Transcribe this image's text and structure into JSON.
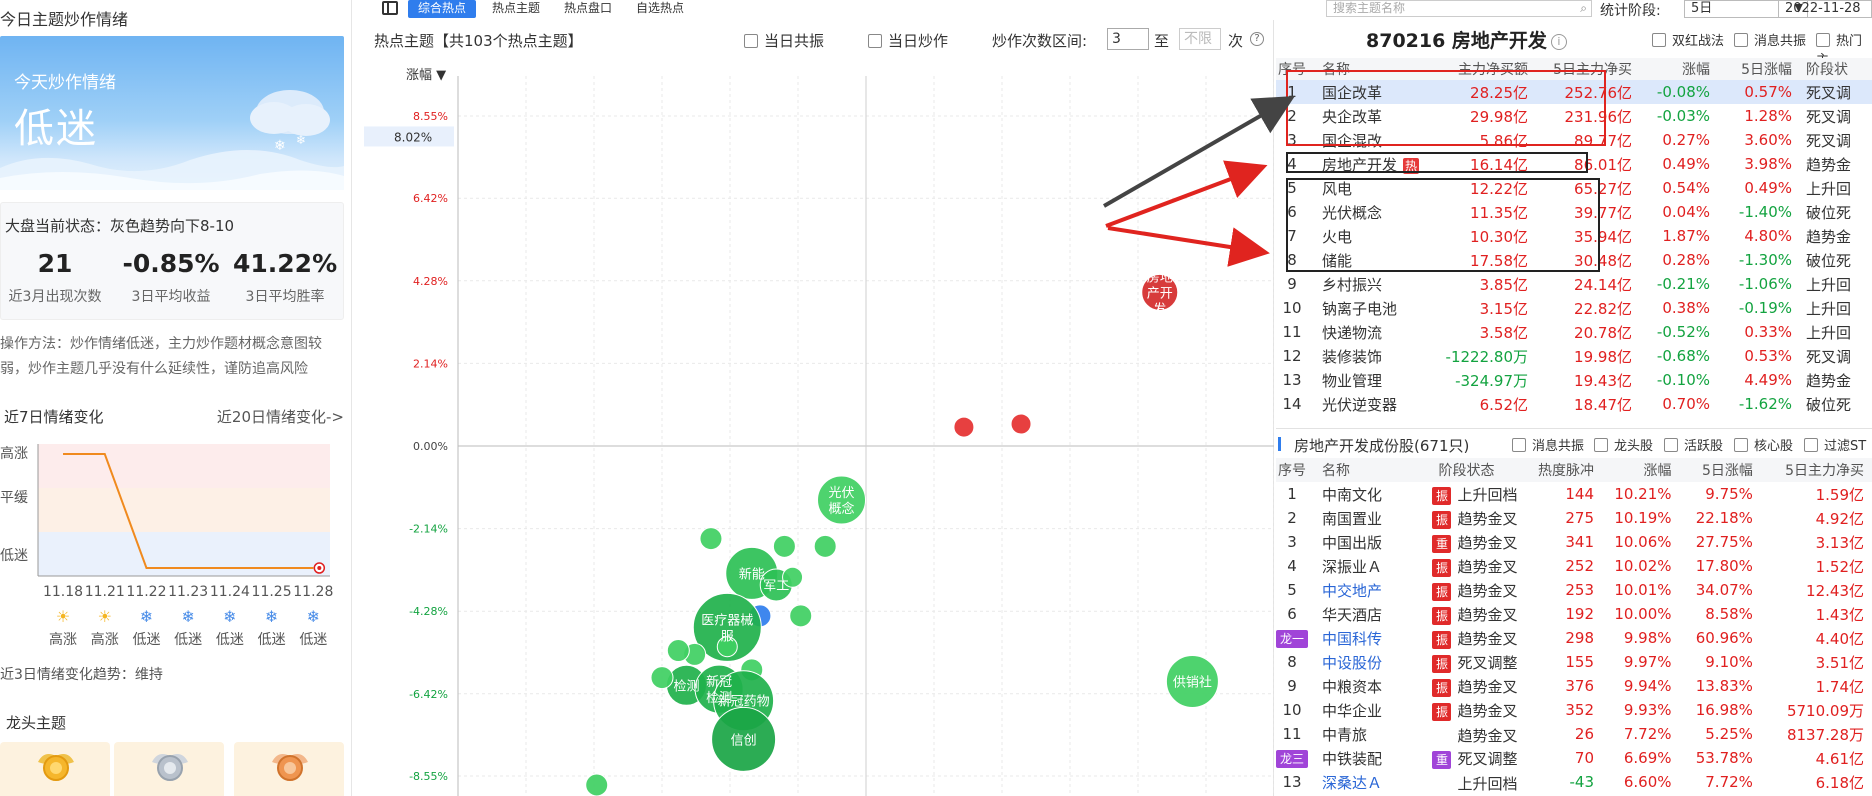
{
  "left": {
    "panel_title": "今日主题炒作情绪",
    "mood_label": "今天炒作情绪",
    "mood_value": "低迷",
    "market_status": "大盘当前状态：灰色趋势向下8-10",
    "kpis": [
      {
        "value": "21",
        "label": "近3月出现次数"
      },
      {
        "value": "-0.85%",
        "label": "3日平均收益"
      },
      {
        "value": "41.22%",
        "label": "3日平均胜率"
      }
    ],
    "method_line1": "操作方法：炒作情绪低迷，主力炒作题材概念意图较",
    "method_line2": "弱，炒作主题几乎没有什么延续性，谨防追高风险",
    "trend_title": "近7日情绪变化",
    "trend_link": "近20日情绪变化->",
    "trend_levels": [
      "高涨",
      "平缓",
      "低迷"
    ],
    "trend_dates": [
      "11.18",
      "11.21",
      "11.22",
      "11.23",
      "11.24",
      "11.25",
      "11.28"
    ],
    "trend_states": [
      "高涨",
      "高涨",
      "低迷",
      "低迷",
      "低迷",
      "低迷",
      "低迷"
    ],
    "trend_icons": [
      "sun-icon",
      "sun-icon",
      "snowflake-icon",
      "snowflake-icon",
      "snowflake-icon",
      "snowflake-icon",
      "snowflake-icon"
    ],
    "trend_note": "近3日情绪变化趋势：维持",
    "dragon_title": "龙头主题"
  },
  "topbar": {
    "tabs": [
      "综合热点",
      "热点主题",
      "热点盘口",
      "自选热点"
    ],
    "active_tab": 0,
    "search_placeholder": "搜索主题名称",
    "stage_label": "统计阶段:",
    "stage_value": "5日",
    "date_value": "2022-11-28"
  },
  "chart_header": {
    "title": "热点主题【共103个热点主题】",
    "check_resonance": "当日共振",
    "check_hype": "当日炒作",
    "range_label": "炒作次数区间:",
    "range_from": "3",
    "range_to_label": "至",
    "range_to_placeholder": "不限",
    "range_unit": "次",
    "sort_label": "涨幅 ▼",
    "current_marker": "8.02%"
  },
  "chart_data": {
    "type": "scatter",
    "ylabel": "涨幅",
    "yticks": [
      "8.55%",
      "6.42%",
      "4.28%",
      "2.14%",
      "0.00%",
      "-2.14%",
      "-4.28%",
      "-6.42%",
      "-8.55%"
    ],
    "ylim": [
      -8.55,
      8.55
    ],
    "bubbles": [
      {
        "label": "房地产开发",
        "y": 3.98,
        "xr": 0.86,
        "r": 18,
        "color": "#d42a2a"
      },
      {
        "label": "",
        "y": 0.49,
        "xr": 0.62,
        "r": 10,
        "color": "#e53030"
      },
      {
        "label": "",
        "y": 0.57,
        "xr": 0.69,
        "r": 10,
        "color": "#e53030"
      },
      {
        "label": "光伏概念",
        "y": -1.4,
        "xr": 0.47,
        "r": 24,
        "color": "#3fcf62"
      },
      {
        "label": "",
        "y": -2.6,
        "xr": 0.4,
        "r": 11,
        "color": "#3fcf62"
      },
      {
        "label": "",
        "y": -2.6,
        "xr": 0.45,
        "r": 11,
        "color": "#3fcf62"
      },
      {
        "label": "",
        "y": -2.4,
        "xr": 0.31,
        "r": 11,
        "color": "#3fcf62"
      },
      {
        "label": "新能",
        "y": -3.3,
        "xr": 0.36,
        "r": 26,
        "color": "#2cc055"
      },
      {
        "label": "军工",
        "y": -3.6,
        "xr": 0.39,
        "r": 16,
        "color": "#2cc055"
      },
      {
        "label": "",
        "y": -3.4,
        "xr": 0.41,
        "r": 10,
        "color": "#3fcf62"
      },
      {
        "label": "",
        "y": -4.4,
        "xr": 0.37,
        "r": 11,
        "color": "#2f7ded"
      },
      {
        "label": "",
        "y": -4.4,
        "xr": 0.42,
        "r": 11,
        "color": "#3fcf62"
      },
      {
        "label": "医疗器械服",
        "y": -4.7,
        "xr": 0.33,
        "r": 34,
        "color": "#1fb14b"
      },
      {
        "label": "",
        "y": -5.2,
        "xr": 0.33,
        "r": 10,
        "color": "#3fcf62"
      },
      {
        "label": "",
        "y": -5.4,
        "xr": 0.29,
        "r": 11,
        "color": "#3fcf62"
      },
      {
        "label": "",
        "y": -5.3,
        "xr": 0.27,
        "r": 11,
        "color": "#3fcf62"
      },
      {
        "label": "",
        "y": -5.8,
        "xr": 0.36,
        "r": 11,
        "color": "#3fcf62"
      },
      {
        "label": "检测",
        "y": -6.2,
        "xr": 0.28,
        "r": 20,
        "color": "#1fb14b"
      },
      {
        "label": "",
        "y": -6.0,
        "xr": 0.25,
        "r": 11,
        "color": "#3fcf62"
      },
      {
        "label": "新冠检测",
        "y": -6.3,
        "xr": 0.32,
        "r": 24,
        "color": "#1fb14b"
      },
      {
        "label": "新冠药物",
        "y": -6.6,
        "xr": 0.35,
        "r": 30,
        "color": "#1fb14b"
      },
      {
        "label": "信创",
        "y": -7.6,
        "xr": 0.35,
        "r": 32,
        "color": "#1aa545"
      },
      {
        "label": "供销社",
        "y": -6.1,
        "xr": 0.9,
        "r": 26,
        "color": "#3fcf62"
      },
      {
        "label": "",
        "y": -9.5,
        "xr": 0.17,
        "r": 11,
        "color": "#3fcf62"
      }
    ]
  },
  "hot_table": {
    "sector_title": "870216 房地产开发",
    "checks": [
      "双红战法",
      "消息共振",
      "热门主"
    ],
    "headers": [
      "序号",
      "名称",
      "主力净买额",
      "5日主力净买",
      "涨幅",
      "5日涨幅",
      "阶段状"
    ],
    "rows": [
      {
        "no": "1",
        "name": "国企改革",
        "net": "28.25亿",
        "net5": "252.76亿",
        "chg": "-0.08%",
        "chg5": "0.57%",
        "stage": "死叉调"
      },
      {
        "no": "2",
        "name": "央企改革",
        "net": "29.98亿",
        "net5": "231.96亿",
        "chg": "-0.03%",
        "chg5": "1.28%",
        "stage": "死叉调"
      },
      {
        "no": "3",
        "name": "国企混改",
        "net": "5.86亿",
        "net5": "89.77亿",
        "chg": "0.27%",
        "chg5": "3.60%",
        "stage": "死叉调"
      },
      {
        "no": "4",
        "name": "房地产开发",
        "net": "16.14亿",
        "net5": "86.01亿",
        "chg": "0.49%",
        "chg5": "3.98%",
        "stage": "趋势金"
      },
      {
        "no": "5",
        "name": "风电",
        "net": "12.22亿",
        "net5": "65.27亿",
        "chg": "0.54%",
        "chg5": "0.49%",
        "stage": "上升回"
      },
      {
        "no": "6",
        "name": "光伏概念",
        "net": "11.35亿",
        "net5": "39.77亿",
        "chg": "0.04%",
        "chg5": "-1.40%",
        "stage": "破位死"
      },
      {
        "no": "7",
        "name": "火电",
        "net": "10.30亿",
        "net5": "35.94亿",
        "chg": "1.87%",
        "chg5": "4.80%",
        "stage": "趋势金"
      },
      {
        "no": "8",
        "name": "储能",
        "net": "17.58亿",
        "net5": "30.48亿",
        "chg": "0.28%",
        "chg5": "-1.30%",
        "stage": "破位死"
      },
      {
        "no": "9",
        "name": "乡村振兴",
        "net": "3.85亿",
        "net5": "24.14亿",
        "chg": "-0.21%",
        "chg5": "-1.06%",
        "stage": "上升回"
      },
      {
        "no": "10",
        "name": "钠离子电池",
        "net": "3.15亿",
        "net5": "22.82亿",
        "chg": "0.38%",
        "chg5": "-0.19%",
        "stage": "上升回"
      },
      {
        "no": "11",
        "name": "快递物流",
        "net": "3.58亿",
        "net5": "20.78亿",
        "chg": "-0.52%",
        "chg5": "0.33%",
        "stage": "上升回"
      },
      {
        "no": "12",
        "name": "装修装饰",
        "net": "-1222.80万",
        "net5": "19.98亿",
        "chg": "-0.68%",
        "chg5": "0.53%",
        "stage": "死叉调"
      },
      {
        "no": "13",
        "name": "物业管理",
        "net": "-324.97万",
        "net5": "19.43亿",
        "chg": "-0.10%",
        "chg5": "4.49%",
        "stage": "趋势金"
      },
      {
        "no": "14",
        "name": "光伏逆变器",
        "net": "6.52亿",
        "net5": "18.47亿",
        "chg": "0.70%",
        "chg5": "-1.62%",
        "stage": "破位死"
      }
    ],
    "hot_tag": "热"
  },
  "const_table": {
    "title": "房地产开发成份股(671只)",
    "checks": [
      "消息共振",
      "龙头股",
      "活跃股",
      "核心股",
      "过滤ST"
    ],
    "headers": [
      "序号",
      "名称",
      "阶段状态",
      "热度脉冲",
      "涨幅",
      "5日涨幅",
      "5日主力净买"
    ],
    "rows": [
      {
        "no": "1",
        "name": "中南文化",
        "badge": "振",
        "bc": "r",
        "stage": "上升回档",
        "heat": "144",
        "chg": "10.21%",
        "chg5": "9.75%",
        "net5": "1.59亿",
        "blue": false
      },
      {
        "no": "2",
        "name": "南国置业",
        "badge": "振",
        "bc": "r",
        "stage": "趋势金叉",
        "heat": "275",
        "chg": "10.19%",
        "chg5": "22.18%",
        "net5": "4.92亿",
        "blue": false
      },
      {
        "no": "3",
        "name": "中国出版",
        "badge": "重",
        "bc": "r",
        "stage": "趋势金叉",
        "heat": "341",
        "chg": "10.06%",
        "chg5": "27.75%",
        "net5": "3.13亿",
        "blue": false
      },
      {
        "no": "4",
        "name": "深振业Ａ",
        "badge": "振",
        "bc": "r",
        "stage": "趋势金叉",
        "heat": "252",
        "chg": "10.02%",
        "chg5": "17.80%",
        "net5": "1.52亿",
        "blue": false
      },
      {
        "no": "5",
        "name": "中交地产",
        "badge": "振",
        "bc": "r",
        "stage": "趋势金叉",
        "heat": "253",
        "chg": "10.01%",
        "chg5": "34.07%",
        "net5": "12.43亿",
        "blue": true
      },
      {
        "no": "6",
        "name": "华天酒店",
        "badge": "振",
        "bc": "r",
        "stage": "趋势金叉",
        "heat": "192",
        "chg": "10.00%",
        "chg5": "8.58%",
        "net5": "1.43亿",
        "blue": false
      },
      {
        "no": "龙一",
        "name": "中国科传",
        "badge": "振",
        "bc": "r",
        "stage": "趋势金叉",
        "heat": "298",
        "chg": "9.98%",
        "chg5": "60.96%",
        "net5": "4.40亿",
        "blue": true
      },
      {
        "no": "8",
        "name": "中设股份",
        "badge": "振",
        "bc": "r",
        "stage": "死叉调整",
        "heat": "155",
        "chg": "9.97%",
        "chg5": "9.10%",
        "net5": "3.51亿",
        "blue": true
      },
      {
        "no": "9",
        "name": "中粮资本",
        "badge": "振",
        "bc": "r",
        "stage": "趋势金叉",
        "heat": "376",
        "chg": "9.94%",
        "chg5": "13.83%",
        "net5": "1.74亿",
        "blue": false
      },
      {
        "no": "10",
        "name": "中华企业",
        "badge": "振",
        "bc": "r",
        "stage": "趋势金叉",
        "heat": "352",
        "chg": "9.93%",
        "chg5": "16.98%",
        "net5": "5710.09万",
        "blue": false
      },
      {
        "no": "11",
        "name": "中青旅",
        "badge": "",
        "bc": "",
        "stage": "趋势金叉",
        "heat": "26",
        "chg": "7.72%",
        "chg5": "5.25%",
        "net5": "8137.28万",
        "blue": false
      },
      {
        "no": "龙三",
        "name": "中铁装配",
        "badge": "重",
        "bc": "p",
        "stage": "死叉调整",
        "heat": "70",
        "chg": "6.69%",
        "chg5": "53.78%",
        "net5": "4.61亿",
        "blue": false
      },
      {
        "no": "13",
        "name": "深桑达Ａ",
        "badge": "",
        "bc": "",
        "stage": "上升回档",
        "heat": "-43",
        "chg": "6.60%",
        "chg5": "7.72%",
        "net5": "6.18亿",
        "blue": true
      }
    ]
  }
}
